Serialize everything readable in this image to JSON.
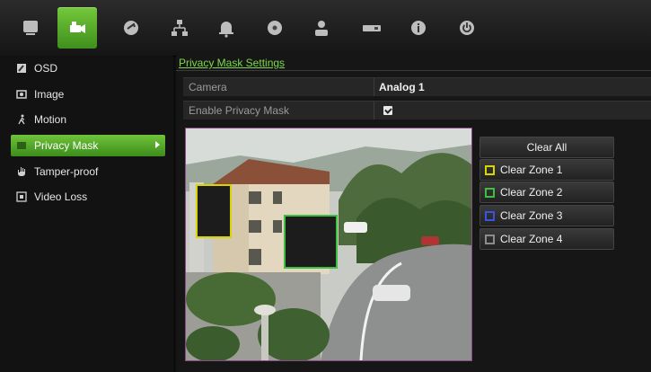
{
  "toolbar": {
    "items": [
      {
        "icon": "monitor-icon"
      },
      {
        "icon": "camera-icon",
        "active": true
      },
      {
        "icon": "record-icon"
      },
      {
        "icon": "network-icon"
      },
      {
        "icon": "alarm-bell-icon"
      },
      {
        "icon": "hdd-icon"
      },
      {
        "icon": "user-icon"
      },
      {
        "icon": "device-icon"
      },
      {
        "icon": "info-icon"
      },
      {
        "icon": "power-icon"
      }
    ],
    "accent": "#5aaf2a"
  },
  "sidebar": {
    "items": [
      {
        "label": "OSD",
        "icon": "osd-icon"
      },
      {
        "label": "Image",
        "icon": "image-icon"
      },
      {
        "label": "Motion",
        "icon": "motion-icon"
      },
      {
        "label": "Privacy Mask",
        "icon": "privacy-mask-icon",
        "active": true
      },
      {
        "label": "Tamper-proof",
        "icon": "tamper-icon"
      },
      {
        "label": "Video Loss",
        "icon": "video-loss-icon"
      }
    ]
  },
  "main": {
    "title": "Privacy Mask Settings",
    "camera": {
      "label": "Camera",
      "value": "Analog 1"
    },
    "enable": {
      "label": "Enable Privacy Mask",
      "checked": true
    },
    "buttons": {
      "clear_all": "Clear All",
      "zones": [
        {
          "label": "Clear Zone 1",
          "color": "#d8d400"
        },
        {
          "label": "Clear Zone 2",
          "color": "#3fbf3f"
        },
        {
          "label": "Clear Zone 3",
          "color": "#3a52e0"
        },
        {
          "label": "Clear Zone 4",
          "color": "#8c8c8c"
        }
      ]
    }
  }
}
